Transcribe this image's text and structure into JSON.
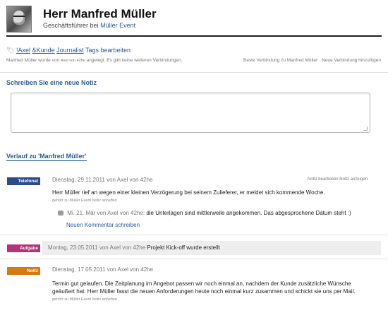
{
  "header": {
    "name": "Herr Manfred Müller",
    "role_prefix": "Geschäftsführer bei",
    "company": "Müller Event"
  },
  "tags": {
    "items": [
      "!Axel",
      "&Kunde",
      "Journalist"
    ],
    "edit": "Tags bearbeiten"
  },
  "connections": {
    "prefix": "Manfred Müller wurde von",
    "author": "Axel von 42he",
    "suffix": "angelegt. Es gibt keine weiteren Verbindungen.",
    "best": "Beste Verbindung zu Manfred Müller",
    "add": "Neue Verbindung hinzufügen"
  },
  "new_note": {
    "heading": "Schreiben Sie eine neue Notiz",
    "value": ""
  },
  "history": {
    "heading": "Verlauf zu 'Manfred Müller'",
    "entries": [
      {
        "badge": "Telefonat",
        "color": "#2b4b8c",
        "meta": "Dienstag, 29.11.2011 von Axel von 42he",
        "actions": "Notiz bearbeiten  Notiz anzeigen",
        "text": "Herr Müller rief an wegen einer kleinen Verzögerung bei seinem Zulieferer, er meldet sich kommende Woche.",
        "attached": "gehört zu Müller Event Notiz anheften",
        "comment_meta": "Mi. 21. Mär von Axel von 42he:",
        "comment_text": "die Unterlagen sind mittlerweile angekommen. Das abgesprochene Datum steht :)",
        "comment_link": "Neuen Kommentar schreiben"
      },
      {
        "badge": "Aufgabe",
        "color": "#b5317a",
        "meta": "Montag, 23.05.2011 von Axel von 42he",
        "text": "Projekt Kick-off wurde erstellt"
      },
      {
        "badge": "Notiz",
        "color": "#d77a12",
        "meta": "Dienstag, 17.05.2011 von Axel von 42he",
        "text_line1": "Termin gut gelaufen. Die Zeitplanung im Angebot passen wir noch einmal an, nachdem der Kunde zusätzliche Wünsche",
        "text_line2": "geäußert hat. Herr Müller fasst die neuen Anforderungen heute noch einmal kurz zusammen und schickt sie uns per Mail.",
        "attached": "gehört zu Müller Event Notiz anheften"
      }
    ]
  }
}
